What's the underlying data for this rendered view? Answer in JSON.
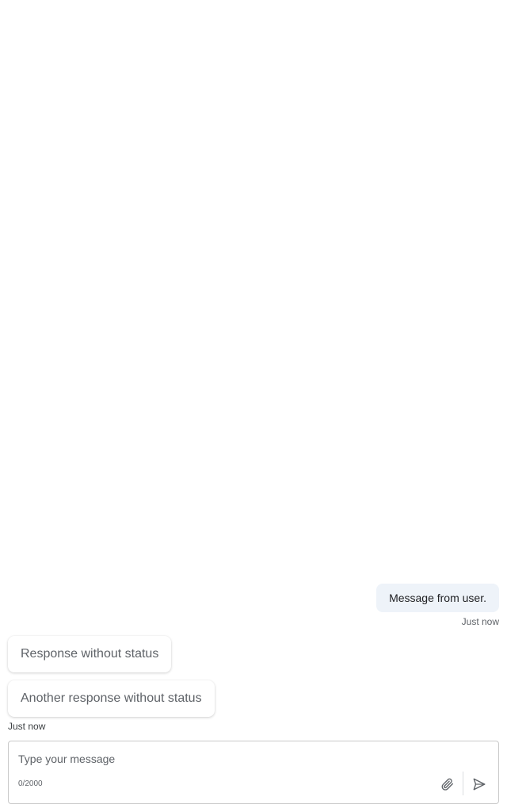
{
  "conversation": {
    "user_message": {
      "text": "Message from user.",
      "timestamp": "Just now"
    },
    "bot_responses": [
      {
        "text": "Response without status"
      },
      {
        "text": "Another response without status"
      }
    ],
    "bot_timestamp": "Just now"
  },
  "composer": {
    "placeholder": "Type your message",
    "value": "",
    "char_count": "0/2000",
    "attach_icon": "paperclip-icon",
    "send_icon": "send-icon"
  },
  "colors": {
    "user_bubble": "#eef3f9",
    "bot_bubble": "#ffffff",
    "border": "#c9c9c9"
  }
}
